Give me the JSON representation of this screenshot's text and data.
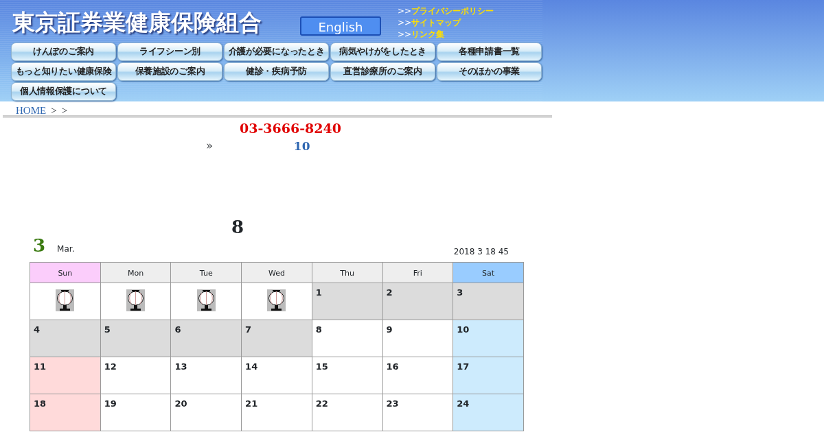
{
  "header": {
    "title": "東京証券業健康保険組合",
    "english_button": "English",
    "links": [
      {
        "prefix": ">>",
        "label": "プライバシーポリシー"
      },
      {
        "prefix": ">>",
        "label": "サイトマップ"
      },
      {
        "prefix": ">>",
        "label": "リンク集"
      }
    ]
  },
  "nav": [
    {
      "label": "けんぽのご案内"
    },
    {
      "label": "ライフシーン別"
    },
    {
      "label": "介護が必要になったとき"
    },
    {
      "label": "病気やけがをしたとき"
    },
    {
      "label": "各種申請書一覧"
    },
    {
      "label": "もっと知りたい健康保険"
    },
    {
      "label": "保養施設のご案内"
    },
    {
      "label": "健診・疾病予防"
    },
    {
      "label": "直営診療所のご案内"
    },
    {
      "label": "そのほかの事業"
    },
    {
      "label": "個人情報保護について"
    }
  ],
  "breadcrumb": {
    "home": "HOME",
    "separators": [
      ">",
      ">"
    ]
  },
  "phone": "03-3666-8240",
  "notice": {
    "marker": "»",
    "number": "10"
  },
  "heading_number": "8",
  "calendar": {
    "month_number": "3",
    "month_name": "Mar.",
    "updated": "2018 3 18 45",
    "weekdays": [
      {
        "label": "Sun",
        "color": "#fbcdfb"
      },
      {
        "label": "Mon",
        "color": "#eeeeee"
      },
      {
        "label": "Tue",
        "color": "#eeeeee"
      },
      {
        "label": "Wed",
        "color": "#eeeeee"
      },
      {
        "label": "Thu",
        "color": "#eeeeee"
      },
      {
        "label": "Fri",
        "color": "#eeeeee"
      },
      {
        "label": "Sat",
        "color": "#99ccff"
      }
    ],
    "weeks": [
      [
        {
          "kind": "lantern"
        },
        {
          "kind": "lantern"
        },
        {
          "kind": "lantern"
        },
        {
          "kind": "lantern"
        },
        {
          "kind": "day",
          "day": "1",
          "color": "#dcdcdc"
        },
        {
          "kind": "day",
          "day": "2",
          "color": "#dcdcdc"
        },
        {
          "kind": "day",
          "day": "3",
          "color": "#dcdcdc"
        }
      ],
      [
        {
          "kind": "day",
          "day": "4",
          "color": "#dcdcdc"
        },
        {
          "kind": "day",
          "day": "5",
          "color": "#dcdcdc"
        },
        {
          "kind": "day",
          "day": "6",
          "color": "#dcdcdc"
        },
        {
          "kind": "day",
          "day": "7",
          "color": "#dcdcdc"
        },
        {
          "kind": "day",
          "day": "8",
          "color": "#ffffff"
        },
        {
          "kind": "day",
          "day": "9",
          "color": "#ffffff"
        },
        {
          "kind": "day",
          "day": "10",
          "color": "#cdebfd"
        }
      ],
      [
        {
          "kind": "day",
          "day": "11",
          "color": "#ffdada"
        },
        {
          "kind": "day",
          "day": "12",
          "color": "#ffffff"
        },
        {
          "kind": "day",
          "day": "13",
          "color": "#ffffff"
        },
        {
          "kind": "day",
          "day": "14",
          "color": "#ffffff"
        },
        {
          "kind": "day",
          "day": "15",
          "color": "#ffffff"
        },
        {
          "kind": "day",
          "day": "16",
          "color": "#ffffff"
        },
        {
          "kind": "day",
          "day": "17",
          "color": "#cdebfd"
        }
      ],
      [
        {
          "kind": "day",
          "day": "18",
          "color": "#ffdada"
        },
        {
          "kind": "day",
          "day": "19",
          "color": "#ffffff"
        },
        {
          "kind": "day",
          "day": "20",
          "color": "#ffffff"
        },
        {
          "kind": "day",
          "day": "21",
          "color": "#ffffff"
        },
        {
          "kind": "day",
          "day": "22",
          "color": "#ffffff"
        },
        {
          "kind": "day",
          "day": "23",
          "color": "#ffffff"
        },
        {
          "kind": "day",
          "day": "24",
          "color": "#cdebfd"
        }
      ]
    ]
  }
}
